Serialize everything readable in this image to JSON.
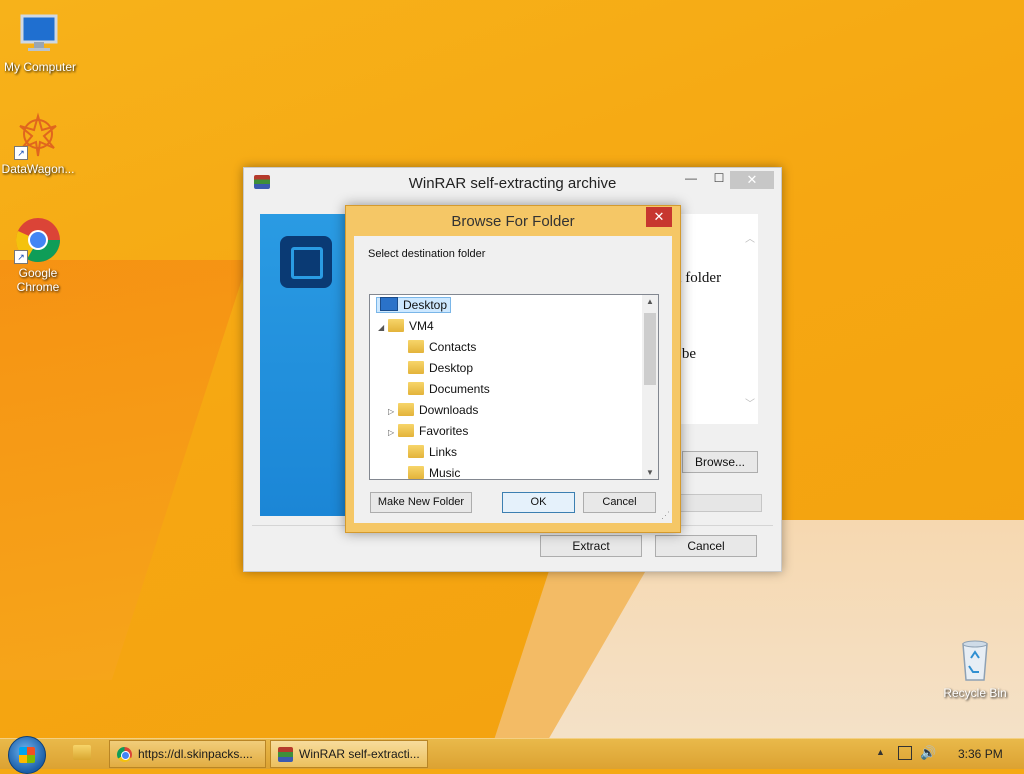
{
  "desktop": {
    "icons": [
      {
        "label": "My Computer"
      },
      {
        "label": "DataWagon..."
      },
      {
        "label": "Google Chrome"
      },
      {
        "label": "Recycle Bin"
      }
    ]
  },
  "winrar": {
    "title": "WinRAR self-extracting archive",
    "text_line1": "n folder",
    "text_line2": "l be",
    "browse_label": "Browse...",
    "extract_label": "Extract",
    "cancel_label": "Cancel"
  },
  "browse": {
    "title": "Browse For Folder",
    "instruction": "Select destination folder",
    "tree": [
      {
        "label": "Desktop",
        "selected": true
      },
      {
        "label": "VM4"
      },
      {
        "label": "Contacts"
      },
      {
        "label": "Desktop"
      },
      {
        "label": "Documents"
      },
      {
        "label": "Downloads"
      },
      {
        "label": "Favorites"
      },
      {
        "label": "Links"
      },
      {
        "label": "Music"
      }
    ],
    "new_folder_label": "Make New Folder",
    "ok_label": "OK",
    "cancel_label": "Cancel"
  },
  "taskbar": {
    "items": [
      {
        "label": "https://dl.skinpacks...."
      },
      {
        "label": "WinRAR self-extracti..."
      }
    ],
    "clock": "3:36 PM"
  }
}
